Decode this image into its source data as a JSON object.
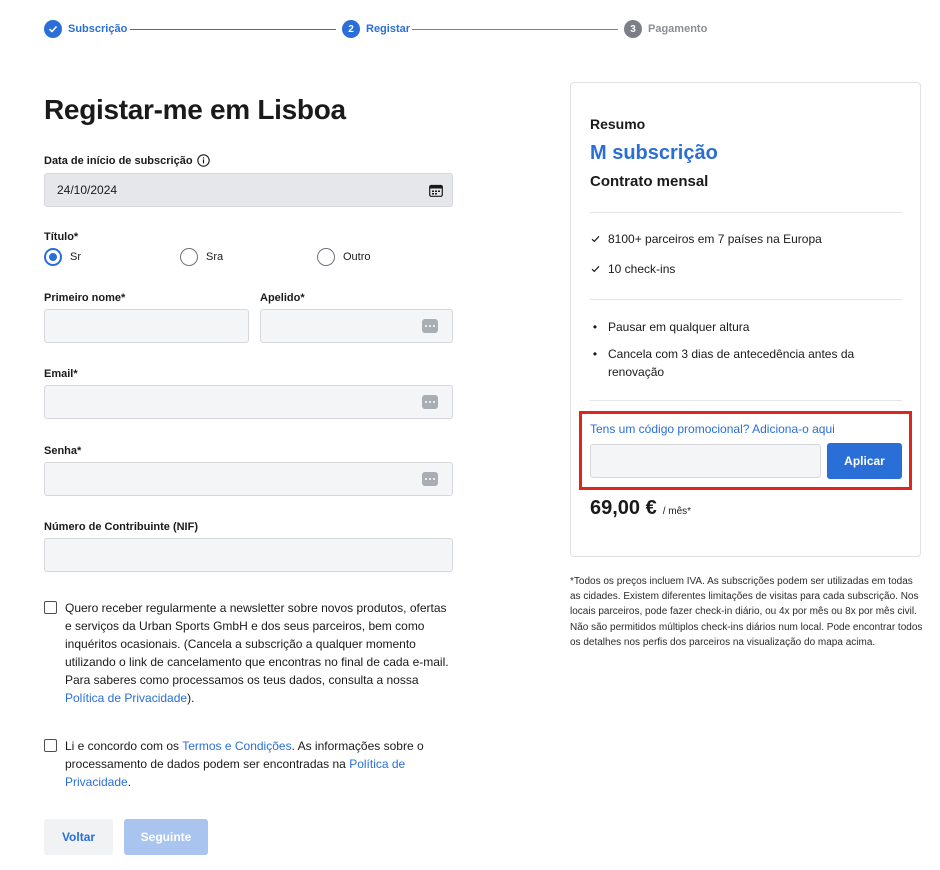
{
  "stepper": {
    "steps": [
      {
        "number": "✓",
        "label": "Subscrição",
        "state": "done"
      },
      {
        "number": "2",
        "label": "Registar",
        "state": "active"
      },
      {
        "number": "3",
        "label": "Pagamento",
        "state": "pending"
      }
    ]
  },
  "page_title": "Registar-me em Lisboa",
  "form": {
    "start_date": {
      "label": "Data de início de subscrição",
      "value": "24/10/2024"
    },
    "title": {
      "label": "Título*",
      "options": [
        "Sr",
        "Sra",
        "Outro"
      ],
      "selected": "Sr"
    },
    "first_name": {
      "label": "Primeiro nome*",
      "value": ""
    },
    "last_name": {
      "label": "Apelido*",
      "value": ""
    },
    "email": {
      "label": "Email*",
      "value": ""
    },
    "password": {
      "label": "Senha*",
      "value": ""
    },
    "nif": {
      "label": "Número de Contribuinte (NIF)",
      "value": ""
    }
  },
  "consents": {
    "newsletter": {
      "checked": false,
      "text": "Quero receber regularmente a newsletter sobre novos produtos, ofertas e serviços da Urban Sports GmbH e dos seus parceiros, bem como inquéritos ocasionais. (Cancela a subscrição a qualquer momento utilizando o link de cancelamento que encontras no final de cada e-mail. Para saberes como processamos os teus dados, consulta a nossa ",
      "link": "Política de Privacidade",
      "suffix": ")."
    },
    "terms": {
      "checked": false,
      "prefix": "Li e concordo com os ",
      "link1": "Termos e Condições",
      "middle": ". As informações sobre o processamento de dados podem ser encontradas na ",
      "link2": "Política de Privacidade",
      "suffix": "."
    }
  },
  "buttons": {
    "back": "Voltar",
    "next": "Seguinte"
  },
  "summary": {
    "heading": "Resumo",
    "plan": "M subscrição",
    "contract": "Contrato mensal",
    "features": [
      "8100+ parceiros em 7 países na Europa",
      "10 check-ins"
    ],
    "conditions": [
      "Pausar em qualquer altura",
      "Cancela com 3 dias de antecedência antes da renovação"
    ],
    "promo_link": "Tens um código promocional? Adiciona-o aqui",
    "promo_button": "Aplicar",
    "price": "69,00 €",
    "price_unit": "/ mês*"
  },
  "footnote": "*Todos os preços incluem IVA. As subscrições podem ser utilizadas em todas as cidades. Existem diferentes limitações de visitas para cada subscrição. Nos locais parceiros, pode fazer check-in diário, ou 4x por mês ou 8x por mês civil. Não são permitidos múltiplos check-ins diários num local. Pode encontrar todos os detalhes nos perfis dos parceiros na visualização do mapa acima.",
  "colors": {
    "accent": "#2a6ed8",
    "highlight_border": "#e0251b",
    "disabled_button": "#a9c4ee"
  }
}
